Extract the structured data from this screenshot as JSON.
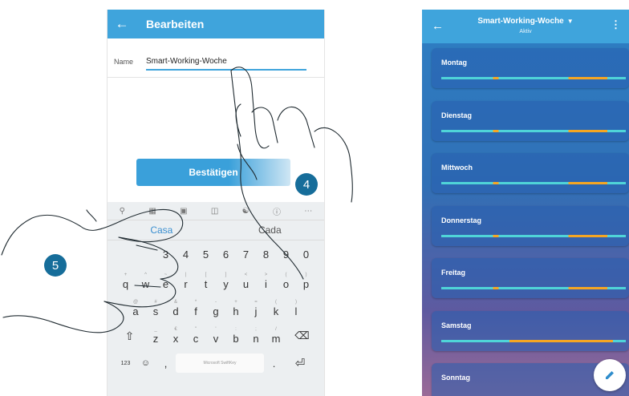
{
  "edit_screen": {
    "title": "Bearbeiten",
    "name_label": "Name",
    "name_value": "Smart-Working-Woche",
    "confirm_label": "Bestätigen"
  },
  "keyboard": {
    "toolbar_icons": [
      "search-icon",
      "gif-icon",
      "sticker-icon",
      "clipboard-icon",
      "translate-icon",
      "info-icon",
      "more-icon"
    ],
    "suggestions": [
      "Casa",
      "Cada"
    ],
    "number_row": [
      "3",
      "4",
      "5",
      "6",
      "7",
      "8",
      "9",
      "0"
    ],
    "row1": [
      {
        "k": "q",
        "s": "+"
      },
      {
        "k": "w",
        "s": "^"
      },
      {
        "k": "e",
        "s": "~"
      },
      {
        "k": "r",
        "s": "|"
      },
      {
        "k": "t",
        "s": "["
      },
      {
        "k": "y",
        "s": "]"
      },
      {
        "k": "u",
        "s": "<"
      },
      {
        "k": "i",
        "s": ">"
      },
      {
        "k": "o",
        "s": "("
      },
      {
        "k": "p",
        "s": ")"
      }
    ],
    "row2": [
      {
        "k": "a",
        "s": "@"
      },
      {
        "k": "s",
        "s": "#"
      },
      {
        "k": "d",
        "s": "&"
      },
      {
        "k": "f",
        "s": "*"
      },
      {
        "k": "g",
        "s": "-"
      },
      {
        "k": "h",
        "s": "+"
      },
      {
        "k": "j",
        "s": "="
      },
      {
        "k": "k",
        "s": "("
      },
      {
        "k": "l",
        "s": ")"
      }
    ],
    "row3": [
      {
        "k": "z",
        "s": "_"
      },
      {
        "k": "x",
        "s": "€"
      },
      {
        "k": "c",
        "s": "\""
      },
      {
        "k": "v",
        "s": "'"
      },
      {
        "k": "b",
        "s": ":"
      },
      {
        "k": "n",
        "s": ";"
      },
      {
        "k": "m",
        "s": "/"
      }
    ],
    "numbers_key": "123",
    "space_label": "Microsoft SwiftKey"
  },
  "steps": {
    "four": "4",
    "five": "5"
  },
  "week_screen": {
    "title": "Smart-Working-Woche",
    "subtitle": "Aktiv",
    "days": [
      "Montag",
      "Dienstag",
      "Mittwoch",
      "Donnerstag",
      "Freitag",
      "Samstag",
      "Sonntag"
    ]
  },
  "colors": {
    "appbar": "#3fa4dc",
    "badge": "#166d9a",
    "bar_cyan": "#4fd4d8",
    "bar_orange": "#f5a623"
  }
}
